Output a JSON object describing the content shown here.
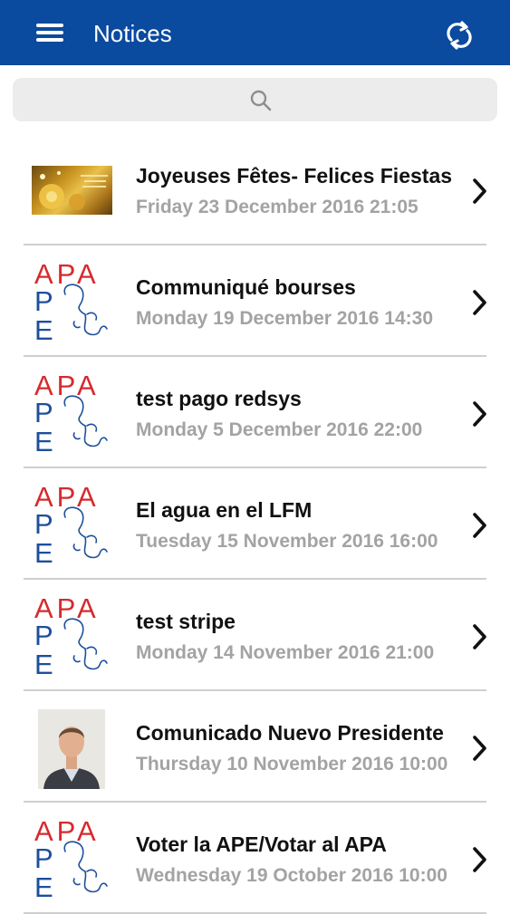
{
  "header": {
    "title": "Notices",
    "menu_icon": "hamburger-menu-icon",
    "refresh_icon": "refresh-icon",
    "background": "#0a4a9f"
  },
  "search": {
    "icon": "search-icon"
  },
  "logo_text": {
    "top": "APA",
    "p": "P",
    "e": "E"
  },
  "notices": [
    {
      "title": "Joyeuses Fêtes- Felices Fiestas",
      "date": "Friday 23 December 2016 21:05",
      "thumb": "christmas-image"
    },
    {
      "title": "Communiqué bourses",
      "date": "Monday 19 December 2016 14:30",
      "thumb": "apa-ape-logo"
    },
    {
      "title": "test pago redsys",
      "date": "Monday 5 December 2016 22:00",
      "thumb": "apa-ape-logo"
    },
    {
      "title": "El agua en el LFM",
      "date": "Tuesday 15 November 2016 16:00",
      "thumb": "apa-ape-logo"
    },
    {
      "title": "test stripe",
      "date": "Monday 14 November 2016 21:00",
      "thumb": "apa-ape-logo"
    },
    {
      "title": "Comunicado Nuevo Presidente",
      "date": "Thursday 10 November 2016 10:00",
      "thumb": "person-photo"
    },
    {
      "title": "Voter la APE/Votar al APA",
      "date": "Wednesday 19 October 2016 10:00",
      "thumb": "apa-ape-logo"
    }
  ]
}
